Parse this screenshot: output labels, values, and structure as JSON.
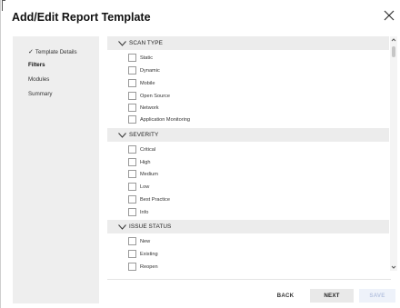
{
  "dialog": {
    "title": "Add/Edit Report Template"
  },
  "sidebar": {
    "items": [
      {
        "label": "Template Details",
        "checked": true,
        "bold": false
      },
      {
        "label": "Filters",
        "checked": false,
        "bold": true
      },
      {
        "label": "Modules",
        "checked": false,
        "bold": false
      },
      {
        "label": "Summary",
        "checked": false,
        "bold": false
      }
    ]
  },
  "sections": [
    {
      "title": "SCAN TYPE",
      "options": [
        "Static",
        "Dynamic",
        "Mobile",
        "Open Source",
        "Network",
        "Application Monitoring"
      ]
    },
    {
      "title": "SEVERITY",
      "options": [
        "Critical",
        "High",
        "Medium",
        "Low",
        "Best Practice",
        "Info"
      ]
    },
    {
      "title": "ISSUE STATUS",
      "options": [
        "New",
        "Existing",
        "Reopen"
      ]
    }
  ],
  "footer": {
    "back_label": "BACK",
    "next_label": "NEXT",
    "save_label": "SAVE"
  },
  "colors": {
    "sidebar_bg": "#eeeeee",
    "section_header_bg": "#ececec",
    "save_disabled_text": "#b8c4e0"
  }
}
